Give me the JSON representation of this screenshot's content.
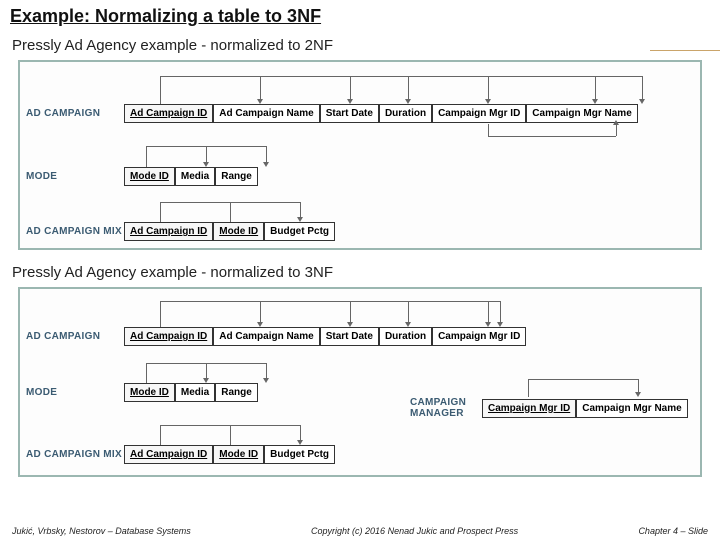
{
  "title": "Example: Normalizing a table to 3NF",
  "sub1": "Pressly Ad Agency example - normalized to 2NF",
  "sub2": "Pressly Ad Agency example - normalized to 3NF",
  "tables2nf": {
    "adcampaign": {
      "name": "AD CAMPAIGN",
      "cols": [
        "Ad Campaign ID",
        "Ad Campaign Name",
        "Start Date",
        "Duration",
        "Campaign Mgr ID",
        "Campaign Mgr Name"
      ],
      "pk": [
        0
      ]
    },
    "mode": {
      "name": "MODE",
      "cols": [
        "Mode ID",
        "Media",
        "Range"
      ],
      "pk": [
        0
      ]
    },
    "mix": {
      "name": "AD CAMPAIGN MIX",
      "cols": [
        "Ad Campaign ID",
        "Mode ID",
        "Budget Pctg"
      ],
      "pk": [
        0,
        1
      ]
    }
  },
  "tables3nf": {
    "adcampaign": {
      "name": "AD CAMPAIGN",
      "cols": [
        "Ad Campaign ID",
        "Ad Campaign Name",
        "Start Date",
        "Duration",
        "Campaign Mgr ID"
      ],
      "pk": [
        0
      ]
    },
    "mode": {
      "name": "MODE",
      "cols": [
        "Mode ID",
        "Media",
        "Range"
      ],
      "pk": [
        0
      ]
    },
    "mgr": {
      "name": "CAMPAIGN MANAGER",
      "cols": [
        "Campaign Mgr ID",
        "Campaign Mgr Name"
      ],
      "pk": [
        0
      ]
    },
    "mix": {
      "name": "AD CAMPAIGN MIX",
      "cols": [
        "Ad Campaign ID",
        "Mode ID",
        "Budget Pctg"
      ],
      "pk": [
        0,
        1
      ]
    }
  },
  "footer": {
    "left": "Jukić, Vrbsky, Nestorov – Database Systems",
    "center": "Copyright (c) 2016 Nenad Jukic and Prospect Press",
    "right": "Chapter 4 – Slide"
  }
}
